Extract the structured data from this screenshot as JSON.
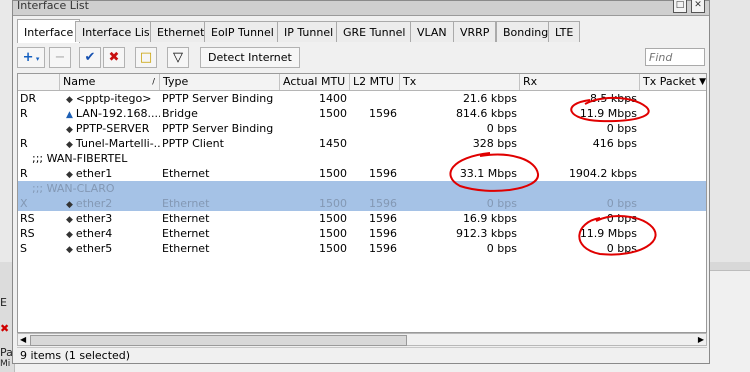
{
  "window": {
    "title": "Interface List"
  },
  "tabs": [
    {
      "label": "Interface"
    },
    {
      "label": "Interface List"
    },
    {
      "label": "Ethernet"
    },
    {
      "label": "EoIP Tunnel"
    },
    {
      "label": "IP Tunnel"
    },
    {
      "label": "GRE Tunnel"
    },
    {
      "label": "VLAN"
    },
    {
      "label": "VRRP"
    },
    {
      "label": "Bonding"
    },
    {
      "label": "LTE"
    }
  ],
  "toolbar": {
    "add_icon": "+",
    "remove_icon": "−",
    "enable_icon": "✔",
    "disable_icon": "✖",
    "comment_icon": "□",
    "filter_icon": "▽",
    "detect_label": "Detect Internet",
    "find_placeholder": "Find"
  },
  "columns": [
    "",
    "Name",
    "Type",
    "Actual MTU",
    "L2 MTU",
    "Tx",
    "Rx",
    "Tx Packet"
  ],
  "rows": [
    {
      "flag": "DR",
      "name": "<pptp-itego>",
      "icon": "◆",
      "type": "PPTP Server Binding",
      "mtu": "1400",
      "l2mtu": "",
      "tx": "21.6 kbps",
      "rx": "8.5 kbps"
    },
    {
      "flag": "R",
      "name": "LAN-192.168....",
      "icon": "▲",
      "type": "Bridge",
      "mtu": "1500",
      "l2mtu": "1596",
      "tx": "814.6 kbps",
      "rx": "11.9 Mbps"
    },
    {
      "flag": "",
      "name": "PPTP-SERVER",
      "icon": "◆",
      "type": "PPTP Server Binding",
      "mtu": "",
      "l2mtu": "",
      "tx": "0 bps",
      "rx": "0 bps"
    },
    {
      "flag": "R",
      "name": "Tunel-Martelli-...",
      "icon": "◆",
      "type": "PPTP Client",
      "mtu": "1450",
      "l2mtu": "",
      "tx": "328 bps",
      "rx": "416 bps"
    },
    {
      "group": ";;; WAN-FIBERTEL"
    },
    {
      "flag": "R",
      "name": "ether1",
      "icon": "◆",
      "type": "Ethernet",
      "mtu": "1500",
      "l2mtu": "1596",
      "tx": "33.1 Mbps",
      "rx": "1904.2 kbps"
    },
    {
      "group": ";;; WAN-CLARO",
      "selected": true
    },
    {
      "flag": "X",
      "name": "ether2",
      "icon": "◆",
      "type": "Ethernet",
      "mtu": "1500",
      "l2mtu": "1596",
      "tx": "0 bps",
      "rx": "0 bps",
      "selected": true
    },
    {
      "flag": "RS",
      "name": "ether3",
      "icon": "◆",
      "type": "Ethernet",
      "mtu": "1500",
      "l2mtu": "1596",
      "tx": "16.9 kbps",
      "rx": "0 bps"
    },
    {
      "flag": "RS",
      "name": "ether4",
      "icon": "◆",
      "type": "Ethernet",
      "mtu": "1500",
      "l2mtu": "1596",
      "tx": "912.3 kbps",
      "rx": "11.9 Mbps"
    },
    {
      "flag": "S",
      "name": "ether5",
      "icon": "◆",
      "type": "Ethernet",
      "mtu": "1500",
      "l2mtu": "1596",
      "tx": "0 bps",
      "rx": "0 bps"
    }
  ],
  "status": {
    "text": "9 items (1 selected)"
  },
  "background": {
    "label_e": "E",
    "label_pas": "Pas",
    "label_mi": "Mi"
  },
  "colors": {
    "selection": "#a5c2e6",
    "annotation": "#e00000"
  }
}
